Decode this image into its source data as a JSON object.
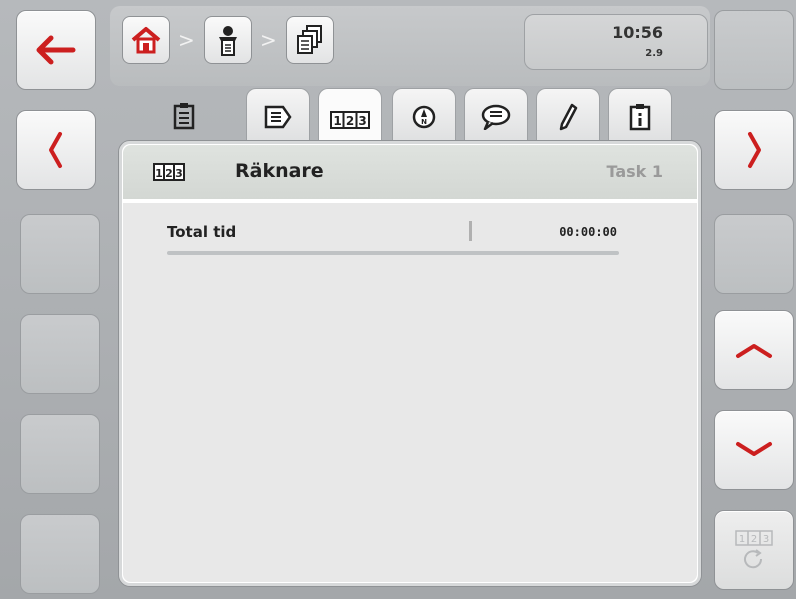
{
  "header": {
    "time": "10:56",
    "version": "2.9",
    "breadcrumb_separator": ">"
  },
  "panel": {
    "title": "Räknare",
    "task": "Task 1"
  },
  "counters": [
    {
      "label": "Total tid",
      "value": "00:00:00"
    }
  ],
  "counter_icon_text": "123",
  "colors": {
    "home_icon": "#cc1f1f",
    "panel_header": "#d8dcd8",
    "panel_body": "#e8e8e8"
  },
  "icons": {
    "back": "arrow-left-icon",
    "prev": "chevron-left-icon",
    "next": "chevron-right-icon",
    "scroll_up": "chevron-up-icon",
    "scroll_down": "chevron-down-icon",
    "reset_counter": "counter-reset-icon"
  }
}
